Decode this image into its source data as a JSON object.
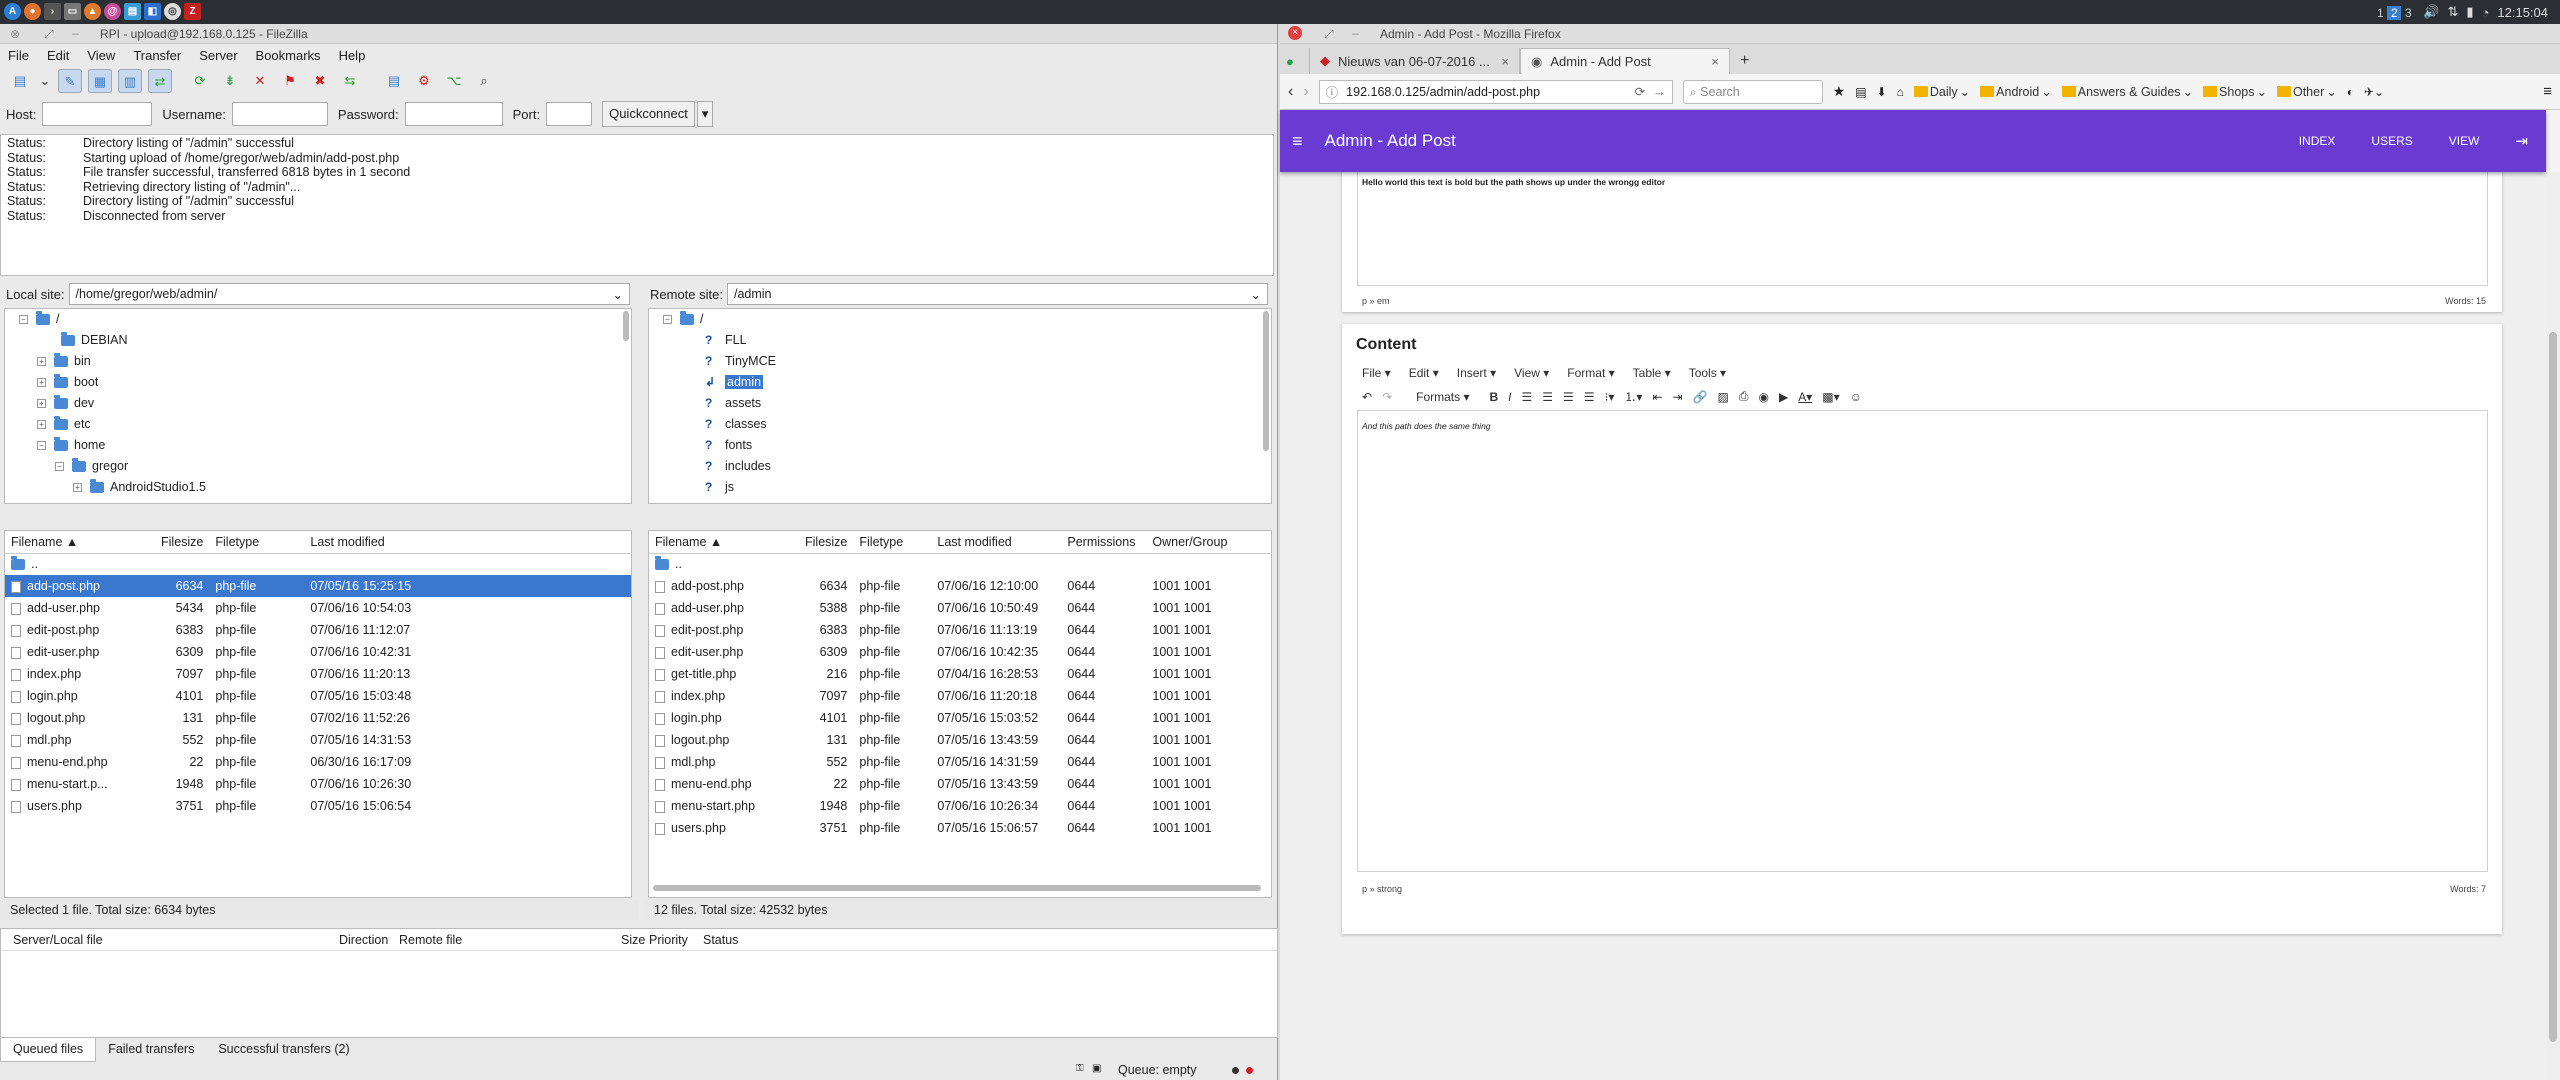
{
  "taskbar": {
    "workspaces": [
      "1",
      "2",
      "3"
    ],
    "clock": "12:15:04"
  },
  "filezilla": {
    "title": "RPI - upload@192.168.0.125 - FileZilla",
    "menu": [
      "File",
      "Edit",
      "View",
      "Transfer",
      "Server",
      "Bookmarks",
      "Help"
    ],
    "quickconnect": {
      "host_label": "Host:",
      "username_label": "Username:",
      "password_label": "Password:",
      "port_label": "Port:",
      "button": "Quickconnect"
    },
    "log": [
      {
        "k": "Status:",
        "v": "Directory listing of \"/admin\" successful"
      },
      {
        "k": "Status:",
        "v": "Starting upload of /home/gregor/web/admin/add-post.php"
      },
      {
        "k": "Status:",
        "v": "File transfer successful, transferred 6818 bytes in 1 second"
      },
      {
        "k": "Status:",
        "v": "Retrieving directory listing of \"/admin\"..."
      },
      {
        "k": "Status:",
        "v": "Directory listing of \"/admin\" successful"
      },
      {
        "k": "Status:",
        "v": "Disconnected from server"
      }
    ],
    "local": {
      "label": "Local site:",
      "path": "/home/gregor/web/admin/",
      "tree": [
        "/",
        "DEBIAN",
        "bin",
        "boot",
        "dev",
        "etc",
        "home",
        "gregor",
        "AndroidStudio1.5"
      ],
      "headers": [
        "Filename",
        "Filesize",
        "Filetype",
        "Last modified"
      ],
      "parent": "..",
      "files": [
        [
          "add-post.php",
          "6634",
          "php-file",
          "07/05/16 15:25:15"
        ],
        [
          "add-user.php",
          "5434",
          "php-file",
          "07/06/16 10:54:03"
        ],
        [
          "edit-post.php",
          "6383",
          "php-file",
          "07/06/16 11:12:07"
        ],
        [
          "edit-user.php",
          "6309",
          "php-file",
          "07/06/16 10:42:31"
        ],
        [
          "index.php",
          "7097",
          "php-file",
          "07/06/16 11:20:13"
        ],
        [
          "login.php",
          "4101",
          "php-file",
          "07/05/16 15:03:48"
        ],
        [
          "logout.php",
          "131",
          "php-file",
          "07/02/16 11:52:26"
        ],
        [
          "mdl.php",
          "552",
          "php-file",
          "07/05/16 14:31:53"
        ],
        [
          "menu-end.php",
          "22",
          "php-file",
          "06/30/16 16:17:09"
        ],
        [
          "menu-start.p...",
          "1948",
          "php-file",
          "07/06/16 10:26:30"
        ],
        [
          "users.php",
          "3751",
          "php-file",
          "07/05/16 15:06:54"
        ]
      ],
      "status": "Selected 1 file. Total size: 6634 bytes"
    },
    "remote": {
      "label": "Remote site:",
      "path": "/admin",
      "tree": [
        "/",
        "FLL",
        "TinyMCE",
        "admin",
        "assets",
        "classes",
        "fonts",
        "includes",
        "js"
      ],
      "headers": [
        "Filename",
        "Filesize",
        "Filetype",
        "Last modified",
        "Permissions",
        "Owner/Group"
      ],
      "parent": "..",
      "files": [
        [
          "add-post.php",
          "6634",
          "php-file",
          "07/06/16 12:10:00",
          "0644",
          "1001 1001"
        ],
        [
          "add-user.php",
          "5388",
          "php-file",
          "07/06/16 10:50:49",
          "0644",
          "1001 1001"
        ],
        [
          "edit-post.php",
          "6383",
          "php-file",
          "07/06/16 11:13:19",
          "0644",
          "1001 1001"
        ],
        [
          "edit-user.php",
          "6309",
          "php-file",
          "07/06/16 10:42:35",
          "0644",
          "1001 1001"
        ],
        [
          "get-title.php",
          "216",
          "php-file",
          "07/04/16 16:28:53",
          "0644",
          "1001 1001"
        ],
        [
          "index.php",
          "7097",
          "php-file",
          "07/06/16 11:20:18",
          "0644",
          "1001 1001"
        ],
        [
          "login.php",
          "4101",
          "php-file",
          "07/05/16 15:03:52",
          "0644",
          "1001 1001"
        ],
        [
          "logout.php",
          "131",
          "php-file",
          "07/05/16 13:43:59",
          "0644",
          "1001 1001"
        ],
        [
          "mdl.php",
          "552",
          "php-file",
          "07/05/16 14:31:59",
          "0644",
          "1001 1001"
        ],
        [
          "menu-end.php",
          "22",
          "php-file",
          "07/05/16 13:43:59",
          "0644",
          "1001 1001"
        ],
        [
          "menu-start.php",
          "1948",
          "php-file",
          "07/06/16 10:26:34",
          "0644",
          "1001 1001"
        ],
        [
          "users.php",
          "3751",
          "php-file",
          "07/05/16 15:06:57",
          "0644",
          "1001 1001"
        ]
      ],
      "status": "12 files. Total size: 42532 bytes"
    },
    "queue": {
      "headers": [
        "Server/Local file",
        "Direction",
        "Remote file",
        "Size",
        "Priority",
        "Status"
      ],
      "tabs": [
        "Queued files",
        "Failed transfers",
        "Successful transfers (2)"
      ],
      "status": "Queue: empty"
    }
  },
  "firefox": {
    "title": "Admin - Add Post - Mozilla Firefox",
    "tabs": [
      "Nieuws van 06-07-2016 ...",
      "Admin - Add Post"
    ],
    "url": "192.168.0.125/admin/add-post.php",
    "search_placeholder": "Search",
    "bookmarks": [
      "Daily",
      "Android",
      "Answers & Guides",
      "Shops",
      "Other"
    ],
    "app": {
      "title": "Admin - Add Post",
      "nav": [
        "INDEX",
        "USERS",
        "VIEW"
      ]
    },
    "editor1": {
      "text": "Hello world this text is bold but the path shows up under the wrongg editor",
      "path": "p » em",
      "words": "Words: 15"
    },
    "editor2": {
      "heading": "Content",
      "menu": [
        "File",
        "Edit",
        "Insert",
        "View",
        "Format",
        "Table",
        "Tools"
      ],
      "formats": "Formats",
      "text": "And this path does the same thing",
      "path": "p » strong",
      "words": "Words: 7"
    }
  }
}
